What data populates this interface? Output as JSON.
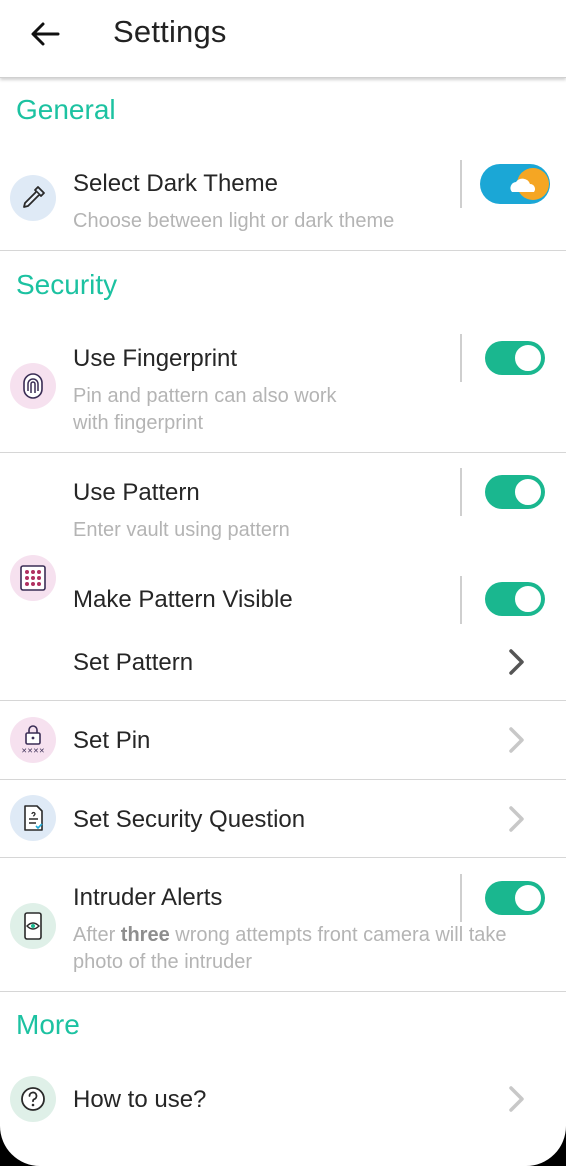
{
  "header": {
    "title": "Settings",
    "back_icon": "arrow-left-icon"
  },
  "colors": {
    "accent": "#1cc2a1",
    "toggle_on": "#1ab78f",
    "theme_toggle": "#1ba7d6",
    "sun": "#f5a623"
  },
  "sections": {
    "general": "General",
    "security": "Security",
    "more": "More"
  },
  "items": {
    "dark_theme": {
      "title": "Select Dark Theme",
      "subtitle": "Choose between light or dark theme",
      "icon": "eyedropper-icon",
      "toggle": "on"
    },
    "fingerprint": {
      "title": "Use Fingerprint",
      "subtitle_line1": "Pin and pattern can also work",
      "subtitle_line2": "with fingerprint",
      "icon": "fingerprint-icon",
      "toggle": "on"
    },
    "use_pattern": {
      "title": "Use Pattern",
      "subtitle": "Enter vault using pattern",
      "icon": "pattern-grid-icon",
      "toggle": "on"
    },
    "pattern_visible": {
      "title": "Make Pattern Visible",
      "toggle": "on"
    },
    "set_pattern": {
      "title": "Set Pattern"
    },
    "set_pin": {
      "title": "Set Pin",
      "icon": "lock-pin-icon"
    },
    "security_question": {
      "title": "Set Security Question",
      "icon": "document-check-icon"
    },
    "intruder": {
      "title": "Intruder Alerts",
      "subtitle_pre": "After ",
      "subtitle_bold": "three",
      "subtitle_post": " wrong attempts front camera will take",
      "subtitle_line2": "photo of the intruder",
      "icon": "phone-eye-icon",
      "toggle": "on"
    },
    "how_to_use": {
      "title": "How to use?",
      "icon": "question-icon"
    }
  }
}
